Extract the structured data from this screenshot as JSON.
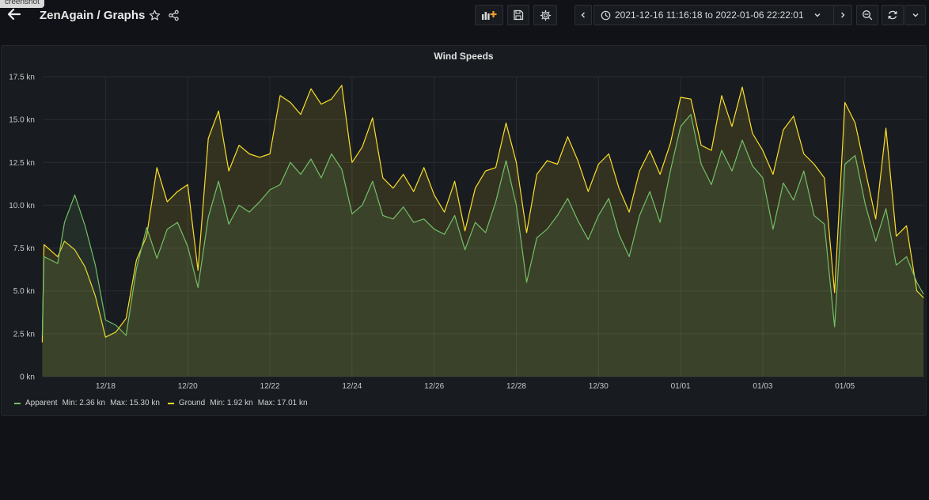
{
  "screenshot_tag": "creenshot",
  "header": {
    "title": "ZenAgain / Graphs",
    "time_range": "2021-12-16 11:16:18 to 2022-01-06 22:22:01"
  },
  "icons": {
    "back": "arrow-left-icon",
    "star": "star-icon",
    "share": "share-icon",
    "add_panel": "add-panel-icon",
    "save": "save-icon",
    "settings": "gear-icon",
    "clock": "clock-icon",
    "caret": "chevron-down-icon",
    "prev": "chevron-left-icon",
    "next": "chevron-right-icon",
    "zoom_out": "zoom-out-icon",
    "refresh": "refresh-icon",
    "refresh_menu": "chevron-down-icon"
  },
  "colors": {
    "apparent": "#73bf69",
    "ground": "#fade2a"
  },
  "panel": {
    "title": "Wind Speeds"
  },
  "legend": {
    "apparent": {
      "name": "Apparent",
      "min": "Min: 2.36 kn",
      "max": "Max: 15.30 kn"
    },
    "ground": {
      "name": "Ground",
      "min": "Min: 1.92 kn",
      "max": "Max: 17.01 kn"
    }
  },
  "chart_data": {
    "type": "area",
    "title": "Wind Speeds",
    "x_range": [
      "2021-12-16 11:16:18",
      "2022-01-06 22:22:01"
    ],
    "x_ticks": [
      "12/18",
      "12/20",
      "12/22",
      "12/24",
      "12/26",
      "12/28",
      "12/30",
      "01/01",
      "01/03",
      "01/05"
    ],
    "y_ticks": [
      "0 kn",
      "2.5 kn",
      "5.0 kn",
      "7.5 kn",
      "10.0 kn",
      "12.5 kn",
      "15.0 kn",
      "17.5 kn"
    ],
    "ylim": [
      0,
      17.5
    ],
    "unit": "kn",
    "grid": true,
    "legend_position": "bottom-left",
    "series": [
      {
        "name": "Apparent",
        "color": "#73bf69",
        "points": [
          [
            "2021-12-16 11:00",
            2.4
          ],
          [
            "2021-12-16 12:00",
            7.0
          ],
          [
            "2021-12-16 20:00",
            6.6
          ],
          [
            "2021-12-17 00:00",
            9.0
          ],
          [
            "2021-12-17 06:00",
            10.6
          ],
          [
            "2021-12-17 12:00",
            8.8
          ],
          [
            "2021-12-17 18:00",
            6.5
          ],
          [
            "2021-12-18 00:00",
            3.3
          ],
          [
            "2021-12-18 06:00",
            3.0
          ],
          [
            "2021-12-18 12:00",
            2.4
          ],
          [
            "2021-12-18 18:00",
            6.3
          ],
          [
            "2021-12-19 00:00",
            8.7
          ],
          [
            "2021-12-19 06:00",
            6.9
          ],
          [
            "2021-12-19 12:00",
            8.6
          ],
          [
            "2021-12-19 18:00",
            9.0
          ],
          [
            "2021-12-20 00:00",
            7.6
          ],
          [
            "2021-12-20 06:00",
            5.2
          ],
          [
            "2021-12-20 12:00",
            9.3
          ],
          [
            "2021-12-20 18:00",
            11.4
          ],
          [
            "2021-12-21 00:00",
            8.9
          ],
          [
            "2021-12-21 06:00",
            10.0
          ],
          [
            "2021-12-21 12:00",
            9.6
          ],
          [
            "2021-12-21 18:00",
            10.2
          ],
          [
            "2021-12-22 00:00",
            10.9
          ],
          [
            "2021-12-22 06:00",
            11.2
          ],
          [
            "2021-12-22 12:00",
            12.5
          ],
          [
            "2021-12-22 18:00",
            11.8
          ],
          [
            "2021-12-23 00:00",
            12.7
          ],
          [
            "2021-12-23 06:00",
            11.6
          ],
          [
            "2021-12-23 12:00",
            13.0
          ],
          [
            "2021-12-23 18:00",
            12.1
          ],
          [
            "2021-12-24 00:00",
            9.5
          ],
          [
            "2021-12-24 06:00",
            10.0
          ],
          [
            "2021-12-24 12:00",
            11.4
          ],
          [
            "2021-12-24 18:00",
            9.4
          ],
          [
            "2021-12-25 00:00",
            9.2
          ],
          [
            "2021-12-25 06:00",
            9.9
          ],
          [
            "2021-12-25 12:00",
            9.0
          ],
          [
            "2021-12-25 18:00",
            9.2
          ],
          [
            "2021-12-26 00:00",
            8.6
          ],
          [
            "2021-12-26 06:00",
            8.3
          ],
          [
            "2021-12-26 12:00",
            9.4
          ],
          [
            "2021-12-26 18:00",
            7.4
          ],
          [
            "2021-12-27 00:00",
            9.0
          ],
          [
            "2021-12-27 06:00",
            8.4
          ],
          [
            "2021-12-27 12:00",
            10.2
          ],
          [
            "2021-12-27 18:00",
            12.6
          ],
          [
            "2021-12-28 00:00",
            10.0
          ],
          [
            "2021-12-28 06:00",
            5.5
          ],
          [
            "2021-12-28 12:00",
            8.1
          ],
          [
            "2021-12-28 18:00",
            8.6
          ],
          [
            "2021-12-29 00:00",
            9.4
          ],
          [
            "2021-12-29 06:00",
            10.4
          ],
          [
            "2021-12-29 12:00",
            9.1
          ],
          [
            "2021-12-29 18:00",
            8.0
          ],
          [
            "2021-12-30 00:00",
            9.4
          ],
          [
            "2021-12-30 06:00",
            10.4
          ],
          [
            "2021-12-30 12:00",
            8.3
          ],
          [
            "2021-12-30 18:00",
            7.0
          ],
          [
            "2021-12-31 00:00",
            9.4
          ],
          [
            "2021-12-31 06:00",
            10.8
          ],
          [
            "2021-12-31 12:00",
            9.0
          ],
          [
            "2021-12-31 18:00",
            12.0
          ],
          [
            "2022-01-01 00:00",
            14.6
          ],
          [
            "2022-01-01 06:00",
            15.3
          ],
          [
            "2022-01-01 12:00",
            12.4
          ],
          [
            "2022-01-01 18:00",
            11.2
          ],
          [
            "2022-01-02 00:00",
            13.2
          ],
          [
            "2022-01-02 06:00",
            12.0
          ],
          [
            "2022-01-02 12:00",
            13.8
          ],
          [
            "2022-01-02 18:00",
            12.3
          ],
          [
            "2022-01-03 00:00",
            11.6
          ],
          [
            "2022-01-03 06:00",
            8.6
          ],
          [
            "2022-01-03 12:00",
            11.3
          ],
          [
            "2022-01-03 18:00",
            10.3
          ],
          [
            "2022-01-04 00:00",
            12.0
          ],
          [
            "2022-01-04 06:00",
            9.4
          ],
          [
            "2022-01-04 12:00",
            8.9
          ],
          [
            "2022-01-04 18:00",
            2.9
          ],
          [
            "2022-01-05 00:00",
            12.4
          ],
          [
            "2022-01-05 06:00",
            12.9
          ],
          [
            "2022-01-05 12:00",
            10.0
          ],
          [
            "2022-01-05 18:00",
            7.9
          ],
          [
            "2022-01-06 00:00",
            9.8
          ],
          [
            "2022-01-06 06:00",
            6.5
          ],
          [
            "2022-01-06 12:00",
            7.0
          ],
          [
            "2022-01-06 18:00",
            5.5
          ],
          [
            "2022-01-06 22:00",
            4.8
          ]
        ]
      },
      {
        "name": "Ground",
        "color": "#fade2a",
        "points": [
          [
            "2021-12-16 11:00",
            2.0
          ],
          [
            "2021-12-16 12:00",
            7.7
          ],
          [
            "2021-12-16 20:00",
            7.0
          ],
          [
            "2021-12-17 00:00",
            7.9
          ],
          [
            "2021-12-17 06:00",
            7.4
          ],
          [
            "2021-12-17 12:00",
            6.4
          ],
          [
            "2021-12-17 18:00",
            4.7
          ],
          [
            "2021-12-18 00:00",
            2.3
          ],
          [
            "2021-12-18 06:00",
            2.6
          ],
          [
            "2021-12-18 12:00",
            3.4
          ],
          [
            "2021-12-18 18:00",
            6.8
          ],
          [
            "2021-12-19 00:00",
            8.2
          ],
          [
            "2021-12-19 06:00",
            12.2
          ],
          [
            "2021-12-19 12:00",
            10.2
          ],
          [
            "2021-12-19 18:00",
            10.8
          ],
          [
            "2021-12-20 00:00",
            11.2
          ],
          [
            "2021-12-20 06:00",
            6.2
          ],
          [
            "2021-12-20 12:00",
            13.9
          ],
          [
            "2021-12-20 18:00",
            15.5
          ],
          [
            "2021-12-21 00:00",
            12.0
          ],
          [
            "2021-12-21 06:00",
            13.5
          ],
          [
            "2021-12-21 12:00",
            13.0
          ],
          [
            "2021-12-21 18:00",
            12.8
          ],
          [
            "2021-12-22 00:00",
            13.0
          ],
          [
            "2021-12-22 06:00",
            16.4
          ],
          [
            "2021-12-22 12:00",
            16.0
          ],
          [
            "2021-12-22 18:00",
            15.3
          ],
          [
            "2021-12-23 00:00",
            16.8
          ],
          [
            "2021-12-23 06:00",
            15.9
          ],
          [
            "2021-12-23 12:00",
            16.2
          ],
          [
            "2021-12-23 18:00",
            17.0
          ],
          [
            "2021-12-24 00:00",
            12.5
          ],
          [
            "2021-12-24 06:00",
            13.4
          ],
          [
            "2021-12-24 12:00",
            15.1
          ],
          [
            "2021-12-24 18:00",
            11.6
          ],
          [
            "2021-12-25 00:00",
            11.0
          ],
          [
            "2021-12-25 06:00",
            11.8
          ],
          [
            "2021-12-25 12:00",
            10.8
          ],
          [
            "2021-12-25 18:00",
            12.2
          ],
          [
            "2021-12-26 00:00",
            10.6
          ],
          [
            "2021-12-26 06:00",
            9.6
          ],
          [
            "2021-12-26 12:00",
            11.4
          ],
          [
            "2021-12-26 18:00",
            8.5
          ],
          [
            "2021-12-27 00:00",
            11.0
          ],
          [
            "2021-12-27 06:00",
            12.0
          ],
          [
            "2021-12-27 12:00",
            12.2
          ],
          [
            "2021-12-27 18:00",
            14.8
          ],
          [
            "2021-12-28 00:00",
            12.5
          ],
          [
            "2021-12-28 06:00",
            8.4
          ],
          [
            "2021-12-28 12:00",
            11.8
          ],
          [
            "2021-12-28 18:00",
            12.6
          ],
          [
            "2021-12-29 00:00",
            12.4
          ],
          [
            "2021-12-29 06:00",
            14.0
          ],
          [
            "2021-12-29 12:00",
            12.6
          ],
          [
            "2021-12-29 18:00",
            10.8
          ],
          [
            "2021-12-30 00:00",
            12.4
          ],
          [
            "2021-12-30 06:00",
            13.0
          ],
          [
            "2021-12-30 12:00",
            11.0
          ],
          [
            "2021-12-30 18:00",
            9.6
          ],
          [
            "2021-12-31 00:00",
            12.0
          ],
          [
            "2021-12-31 06:00",
            13.2
          ],
          [
            "2021-12-31 12:00",
            11.8
          ],
          [
            "2021-12-31 18:00",
            13.6
          ],
          [
            "2022-01-01 00:00",
            16.3
          ],
          [
            "2022-01-01 06:00",
            16.2
          ],
          [
            "2022-01-01 12:00",
            13.5
          ],
          [
            "2022-01-01 18:00",
            13.2
          ],
          [
            "2022-01-02 00:00",
            16.4
          ],
          [
            "2022-01-02 06:00",
            14.6
          ],
          [
            "2022-01-02 12:00",
            16.9
          ],
          [
            "2022-01-02 18:00",
            14.2
          ],
          [
            "2022-01-03 00:00",
            13.2
          ],
          [
            "2022-01-03 06:00",
            11.8
          ],
          [
            "2022-01-03 12:00",
            14.4
          ],
          [
            "2022-01-03 18:00",
            15.2
          ],
          [
            "2022-01-04 00:00",
            13.0
          ],
          [
            "2022-01-04 06:00",
            12.4
          ],
          [
            "2022-01-04 12:00",
            11.6
          ],
          [
            "2022-01-04 18:00",
            4.9
          ],
          [
            "2022-01-05 00:00",
            16.0
          ],
          [
            "2022-01-05 06:00",
            14.8
          ],
          [
            "2022-01-05 12:00",
            12.0
          ],
          [
            "2022-01-05 18:00",
            9.2
          ],
          [
            "2022-01-06 00:00",
            14.5
          ],
          [
            "2022-01-06 06:00",
            8.2
          ],
          [
            "2022-01-06 12:00",
            8.8
          ],
          [
            "2022-01-06 18:00",
            5.0
          ],
          [
            "2022-01-06 22:00",
            4.6
          ]
        ]
      }
    ]
  }
}
